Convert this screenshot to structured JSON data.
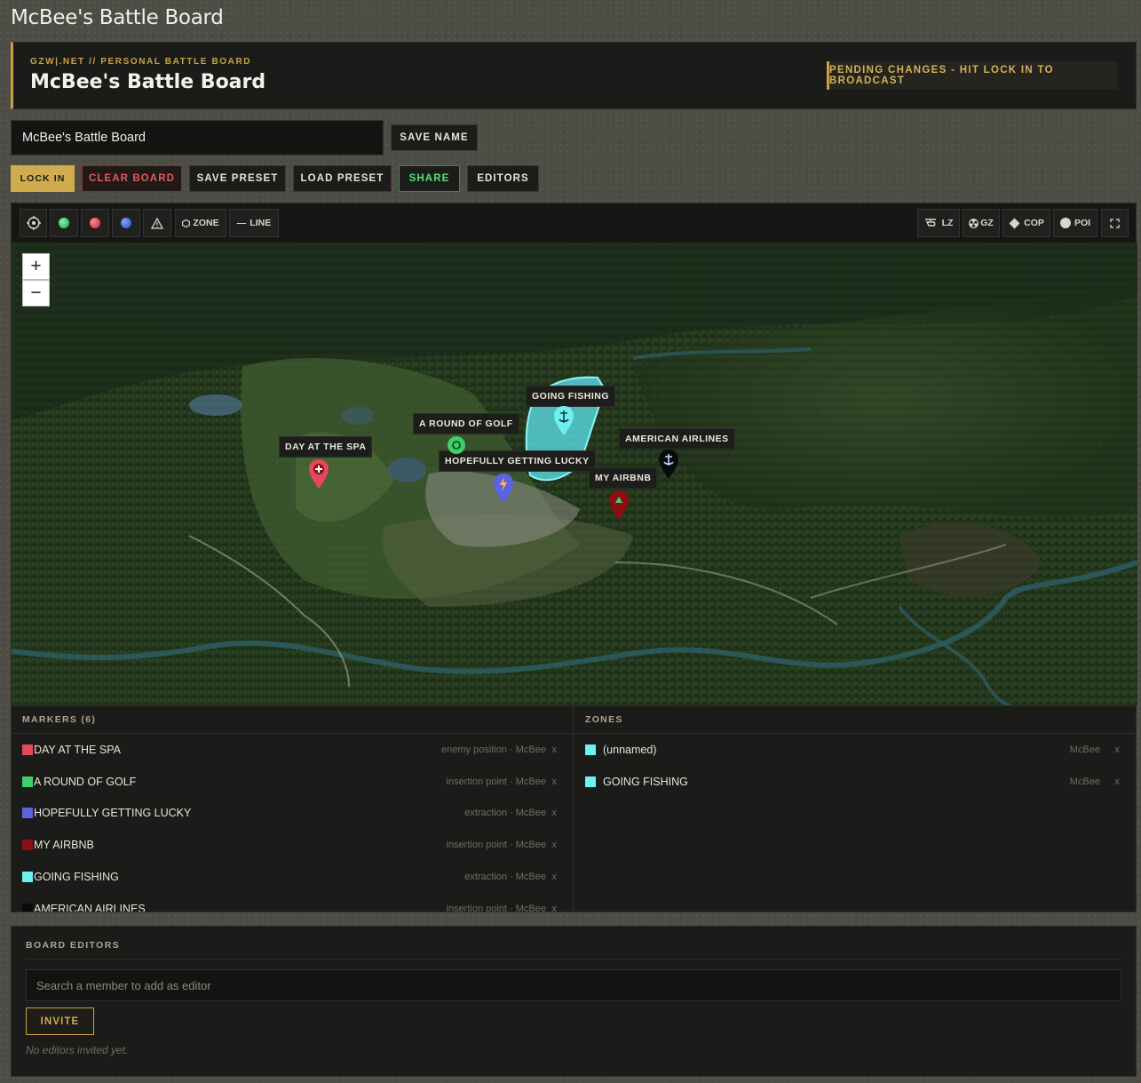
{
  "window": {
    "title": "McBee's Battle Board"
  },
  "header": {
    "subtitle": "GZW|.NET // PERSONAL BATTLE BOARD",
    "title": "McBee's Battle Board",
    "pending": "PENDING CHANGES - HIT LOCK IN TO BROADCAST"
  },
  "name_form": {
    "value": "McBee's Battle Board",
    "save_label": "SAVE NAME"
  },
  "actions": {
    "lock_in": "LOCK IN",
    "clear_board": "CLEAR BOARD",
    "save_preset": "SAVE PRESET",
    "load_preset": "LOAD PRESET",
    "share": "SHARE",
    "editors": "EDITORS"
  },
  "toolbar": {
    "zone": "ZONE",
    "line": "LINE",
    "lz": "LZ",
    "gz": "GZ",
    "cop": "COP",
    "poi": "POI",
    "dot_colors": {
      "green": "#3ecf6a",
      "red": "#e5475b",
      "blue": "#3f74d8"
    }
  },
  "map": {
    "zoom_in": "+",
    "zoom_out": "−",
    "labels": {
      "going_fishing": "GOING FISHING",
      "round_of_golf": "A ROUND OF GOLF",
      "day_at_spa": "DAY AT THE SPA",
      "getting_lucky": "HOPEFULLY GETTING LUCKY",
      "american_airlines": "AMERICAN AIRLINES",
      "my_airbnb": "MY AIRBNB"
    }
  },
  "markers": {
    "heading": "MARKERS (6)",
    "items": [
      {
        "name": "DAY AT THE SPA",
        "meta": "enemy position · McBee",
        "remove": "x",
        "color": "#e5475b"
      },
      {
        "name": "A ROUND OF GOLF",
        "meta": "insertion point · McBee",
        "remove": "x",
        "color": "#3ecf6a"
      },
      {
        "name": "HOPEFULLY GETTING LUCKY",
        "meta": "extraction · McBee",
        "remove": "x",
        "color": "#5b63e0"
      },
      {
        "name": "MY AIRBNB",
        "meta": "insertion point · McBee",
        "remove": "x",
        "color": "#8a0f12"
      },
      {
        "name": "GOING FISHING",
        "meta": "extraction · McBee",
        "remove": "x",
        "color": "#6cf0f0"
      },
      {
        "name": "AMERICAN AIRLINES",
        "meta": "insertion point · McBee",
        "remove": "x",
        "color": "#0b0b0b"
      }
    ]
  },
  "zones": {
    "heading": "ZONES",
    "items": [
      {
        "name": "(unnamed)",
        "meta": "McBee",
        "remove": "x",
        "color": "#6cf0f0"
      },
      {
        "name": "GOING FISHING",
        "meta": "McBee",
        "remove": "x",
        "color": "#6cf0f0"
      }
    ]
  },
  "editors": {
    "title": "BOARD EDITORS",
    "search_placeholder": "Search a member to add as editor",
    "invite": "INVITE",
    "empty": "No editors invited yet."
  }
}
